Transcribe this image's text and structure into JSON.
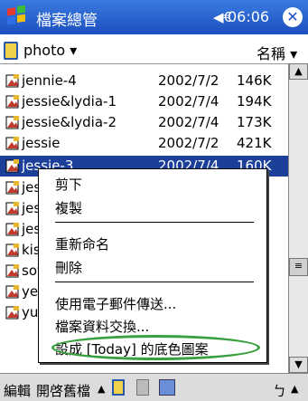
{
  "titlebar": {
    "title": "檔案總管",
    "speaker_icon": "speaker-icon",
    "time": "06:06",
    "close_label": "✕"
  },
  "folderbar": {
    "folder": "photo ▾",
    "sort": "名稱 ▾"
  },
  "files": [
    {
      "name": "jennie-4",
      "date": "2002/7/2",
      "size": "146K"
    },
    {
      "name": "jessie&lydia-1",
      "date": "2002/7/4",
      "size": "194K"
    },
    {
      "name": "jessie&lydia-2",
      "date": "2002/7/4",
      "size": "173K"
    },
    {
      "name": "jessie",
      "date": "2002/7/2",
      "size": "421K"
    },
    {
      "name": "jessie-3",
      "date": "2002/7/4",
      "size": "160K"
    },
    {
      "name": "jessi"
    },
    {
      "name": "jessi"
    },
    {
      "name": "jessi"
    },
    {
      "name": "kiss-"
    },
    {
      "name": "sofa-"
    },
    {
      "name": "yes-"
    },
    {
      "name": "yu-s"
    }
  ],
  "menu": {
    "cut": "剪下",
    "copy": "複製",
    "rename": "重新命名",
    "delete": "刪除",
    "send_email": "使用電子郵件傳送...",
    "beam": "檔案資料交換...",
    "set_today_bg": "設成 [Today] 的底色圖案"
  },
  "bottombar": {
    "edit": "編輯",
    "open": "開啓舊檔",
    "up_arrow": "▲",
    "input_arrow": "▲"
  },
  "colors": {
    "titlebar": "#1c4fbf",
    "selection": "#1c3f9a",
    "highlight_oval": "#3aa040"
  }
}
